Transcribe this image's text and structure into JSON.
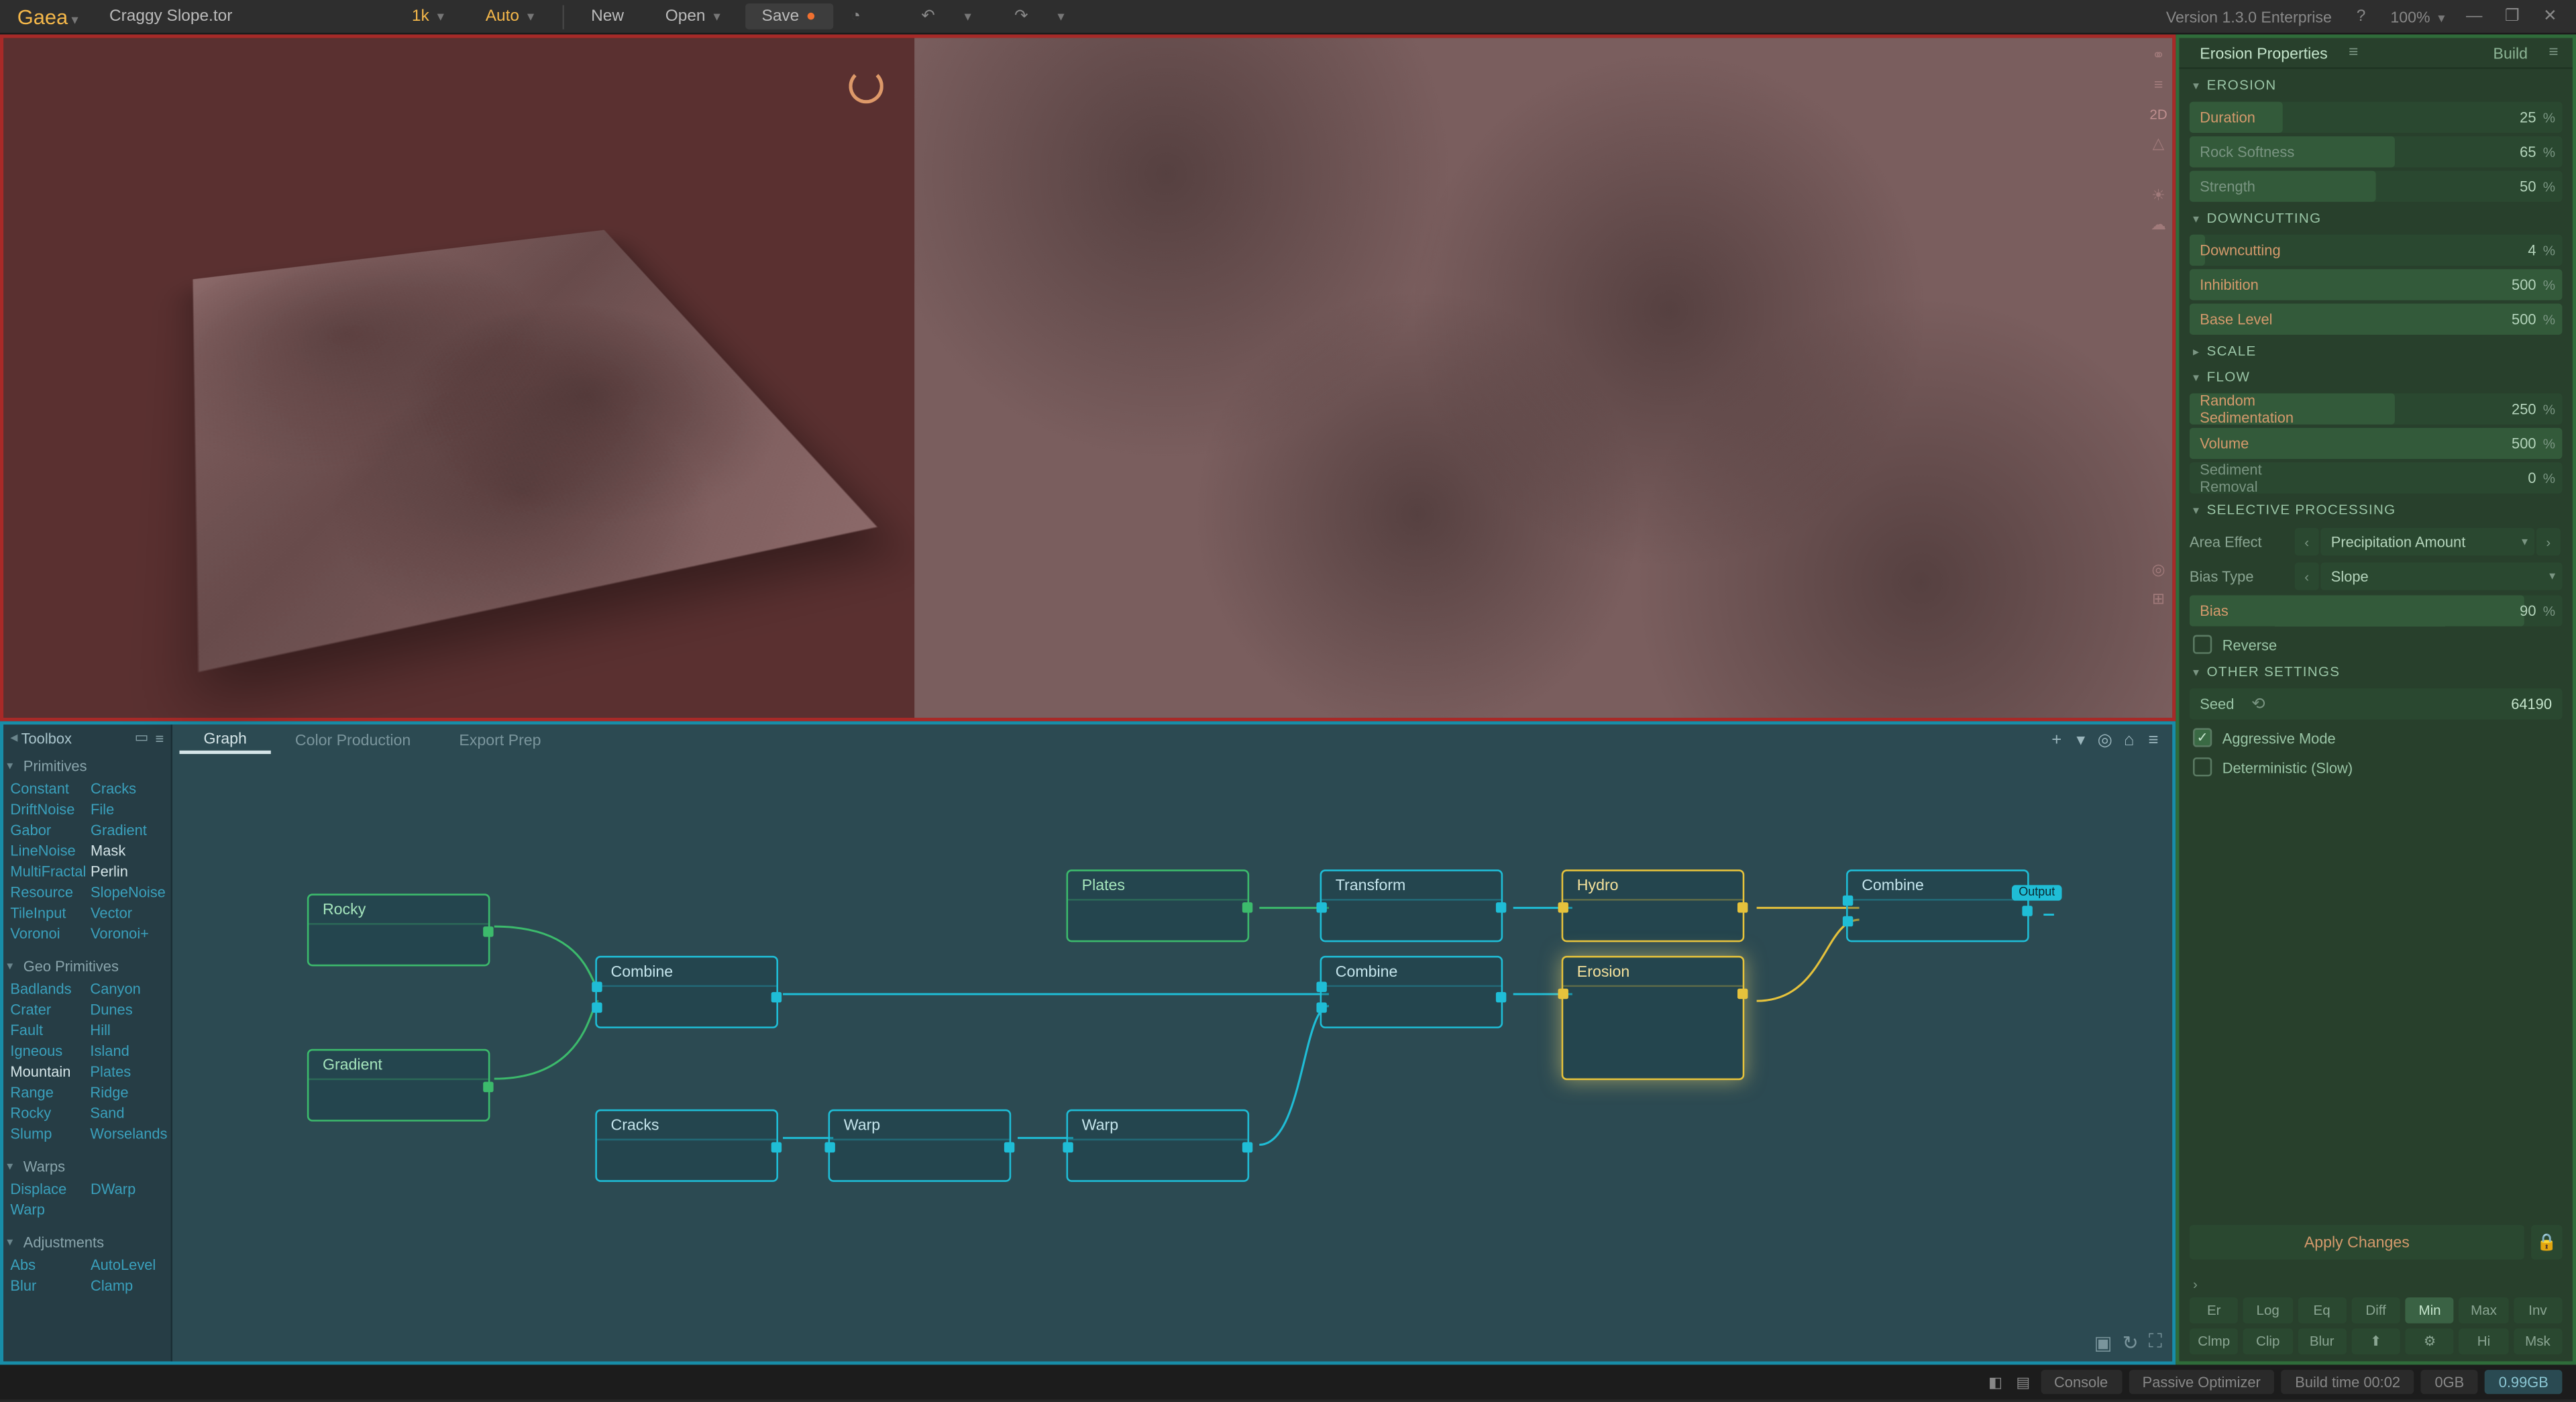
{
  "app": {
    "name": "Gaea",
    "file": "Craggy Slope.tor",
    "version": "Version 1.3.0 Enterprise",
    "zoom": "100%"
  },
  "top": {
    "res": "1k",
    "auto": "Auto",
    "new": "New",
    "open": "Open",
    "save": "Save"
  },
  "viewport": {
    "mode2d": "2D"
  },
  "toolbox": {
    "title": "Toolbox",
    "sections": [
      {
        "name": "Primitives",
        "items": [
          "Constant",
          "Cracks",
          "DriftNoise",
          "File",
          "Gabor",
          "Gradient",
          "LineNoise",
          "Mask",
          "MultiFractal",
          "Perlin",
          "Resource",
          "SlopeNoise",
          "TileInput",
          "Vector",
          "Voronoi",
          "Voronoi+"
        ],
        "hl": [
          "Mask",
          "Perlin"
        ]
      },
      {
        "name": "Geo Primitives",
        "items": [
          "Badlands",
          "Canyon",
          "Crater",
          "Dunes",
          "Fault",
          "Hill",
          "Igneous",
          "Island",
          "Mountain",
          "Plates",
          "Range",
          "Ridge",
          "Rocky",
          "Sand",
          "Slump",
          "Worselands"
        ],
        "hl": [
          "Mountain"
        ]
      },
      {
        "name": "Warps",
        "items": [
          "Displace",
          "DWarp",
          "Warp",
          ""
        ],
        "hl": []
      },
      {
        "name": "Adjustments",
        "items": [
          "Abs",
          "AutoLevel",
          "Blur",
          "Clamp"
        ],
        "hl": []
      }
    ]
  },
  "graph": {
    "tabs": [
      "Graph",
      "Color Production",
      "Export Prep"
    ],
    "nodes": {
      "rocky": "Rocky",
      "gradient": "Gradient",
      "combine1": "Combine",
      "cracks": "Cracks",
      "warp1": "Warp",
      "warp2": "Warp",
      "plates": "Plates",
      "transform": "Transform",
      "hydro": "Hydro",
      "combine2": "Combine",
      "erosion": "Erosion",
      "combine3": "Combine",
      "output": "Output"
    }
  },
  "props": {
    "title": "Erosion Properties",
    "build": "Build",
    "erosion_sec": "EROSION",
    "duration_lbl": "Duration",
    "duration_val": "25",
    "rocksoft_lbl": "Rock Softness",
    "rocksoft_val": "65",
    "strength_lbl": "Strength",
    "strength_val": "50",
    "down_sec": "DOWNCUTTING",
    "downcut_lbl": "Downcutting",
    "downcut_val": "4",
    "inhib_lbl": "Inhibition",
    "inhib_val": "500",
    "base_lbl": "Base Level",
    "base_val": "500",
    "scale_sec": "SCALE",
    "flow_sec": "FLOW",
    "randsed_lbl": "Random Sedimentation",
    "randsed_val": "250",
    "volume_lbl": "Volume",
    "volume_val": "500",
    "sedrem_lbl": "Sediment Removal",
    "sedrem_val": "0",
    "selproc_sec": "SELECTIVE PROCESSING",
    "areaeff_lbl": "Area Effect",
    "areaeff_val": "Precipitation Amount",
    "biastype_lbl": "Bias Type",
    "biastype_val": "Slope",
    "bias_lbl": "Bias",
    "bias_val": "90",
    "reverse_lbl": "Reverse",
    "other_sec": "OTHER SETTINGS",
    "seed_lbl": "Seed",
    "seed_val": "64190",
    "aggr_lbl": "Aggressive Mode",
    "determ_lbl": "Deterministic (Slow)",
    "apply": "Apply Changes",
    "qb1": [
      "Er",
      "Log",
      "Eq",
      "Diff",
      "Min",
      "Max",
      "Inv"
    ],
    "qb2": [
      "Clmp",
      "Clip",
      "Blur",
      "⬆",
      "⚙",
      "Hi",
      "Msk"
    ]
  },
  "status": {
    "console": "Console",
    "passive": "Passive Optimizer",
    "build": "Build time 00:02",
    "mem1": "0GB",
    "mem2": "0.99GB"
  }
}
